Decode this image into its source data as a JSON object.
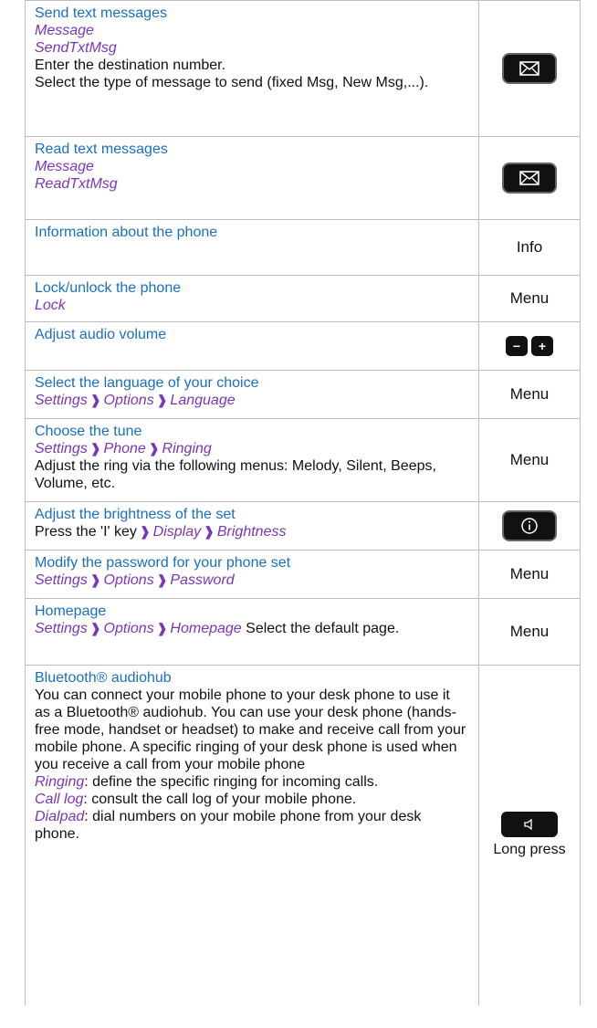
{
  "rows": [
    {
      "title": "Send text messages",
      "path1": "Message",
      "path2": "SendTxtMsg",
      "text1": "Enter the destination number.",
      "text2": "Select the type of message to send (fixed Msg, New Msg,...).",
      "key_icon": "envelope-icon"
    },
    {
      "title": "Read text messages",
      "path1": "Message",
      "path2": "ReadTxtMsg",
      "key_icon": "envelope-icon"
    },
    {
      "title": "Information about the phone",
      "key_label": "Info"
    },
    {
      "title": "Lock/unlock the phone",
      "path1": "Lock",
      "key_label": "Menu"
    },
    {
      "title": "Adjust audio volume",
      "key_minus": "−",
      "key_plus": "+"
    },
    {
      "title": "Select the language of your choice",
      "path": [
        "Settings",
        "Options",
        "Language"
      ],
      "key_label": "Menu"
    },
    {
      "title": "Choose the tune",
      "path": [
        "Settings",
        "Phone",
        "Ringing"
      ],
      "text": "Adjust the ring via the following menus: Melody, Silent, Beeps, Volume, etc.",
      "key_label": "Menu"
    },
    {
      "title": "Adjust the brightness of the set",
      "text_prefix": "Press the 'I' key",
      "path": [
        "Display",
        "Brightness"
      ],
      "key_icon": "info-icon"
    },
    {
      "title": "Modify the password for your phone set",
      "path": [
        "Settings",
        "Options",
        "Password"
      ],
      "key_label": "Menu"
    },
    {
      "title": "Homepage",
      "path": [
        "Settings",
        "Options",
        "Homepage"
      ],
      "text": "Select the default page.",
      "key_label": "Menu"
    },
    {
      "title": "Bluetooth® audiohub",
      "text": "You can connect your mobile phone to your desk phone to use it as a Bluetooth® audiohub. You can use your desk phone (hands-free mode, handset or headset) to make and receive call from your mobile phone. A specific ringing of your desk phone is used when you receive a call from your mobile phone",
      "items": [
        {
          "term": "Ringing",
          "desc": ": define the specific ringing for incoming calls."
        },
        {
          "term": "Call log",
          "desc": ": consult the call log of your mobile phone."
        },
        {
          "term": "Dialpad",
          "desc": ": dial numbers on your mobile phone from your desk phone."
        }
      ],
      "key_icon": "speaker-icon",
      "key_caption": "Long press"
    }
  ],
  "colors": {
    "title": "#1a6fc4",
    "path": "#7b35b8",
    "border": "#bdbdbd"
  }
}
